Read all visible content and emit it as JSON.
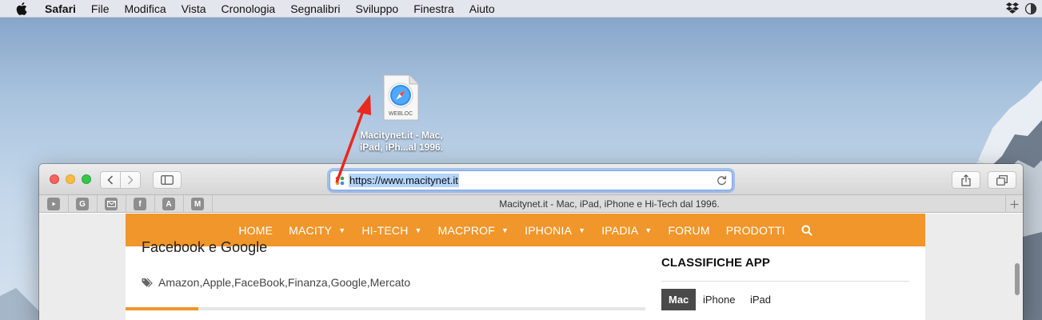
{
  "menubar": {
    "items": [
      {
        "label": "Safari",
        "bold": true
      },
      {
        "label": "File"
      },
      {
        "label": "Modifica"
      },
      {
        "label": "Vista"
      },
      {
        "label": "Cronologia"
      },
      {
        "label": "Segnalibri"
      },
      {
        "label": "Sviluppo"
      },
      {
        "label": "Finestra"
      },
      {
        "label": "Aiuto"
      }
    ]
  },
  "desktop_file": {
    "badge": "WEBLOC",
    "label_line1": "Macitynet.it - Mac,",
    "label_line2": "iPad, iPh...al 1996."
  },
  "browser": {
    "url": "https://www.macitynet.it",
    "tab_title": "Macitynet.it - Mac, iPad, iPhone e Hi-Tech dal 1996.",
    "favorites": [
      {
        "letter": "",
        "icon": "youtube-icon"
      },
      {
        "letter": "G",
        "icon": "google-icon"
      },
      {
        "letter": "",
        "icon": "mail-icon"
      },
      {
        "letter": "f",
        "icon": "facebook-icon"
      },
      {
        "letter": "A",
        "icon": "app-a-icon"
      },
      {
        "letter": "M",
        "icon": "app-m-icon"
      }
    ],
    "accent": "#f0962a"
  },
  "site": {
    "nav": [
      {
        "label": "HOME",
        "dropdown": false
      },
      {
        "label": "MACITY",
        "dropdown": true
      },
      {
        "label": "HI-TECH",
        "dropdown": true
      },
      {
        "label": "MACPROF",
        "dropdown": true
      },
      {
        "label": "IPHONIA",
        "dropdown": true
      },
      {
        "label": "IPADIA",
        "dropdown": true
      },
      {
        "label": "FORUM",
        "dropdown": false
      },
      {
        "label": "PRODOTTI",
        "dropdown": false
      }
    ],
    "article_title": "Facebook e Google",
    "tags": [
      "Amazon",
      "Apple",
      "FaceBook",
      "Finanza",
      "Google",
      "Mercato"
    ],
    "tags_separator": ", ",
    "reading_progress": 0.14,
    "widget": {
      "title": "CLASSIFICHE APP",
      "tabs": [
        {
          "label": "Mac",
          "active": true
        },
        {
          "label": "iPhone",
          "active": false
        },
        {
          "label": "iPad",
          "active": false
        }
      ]
    }
  }
}
